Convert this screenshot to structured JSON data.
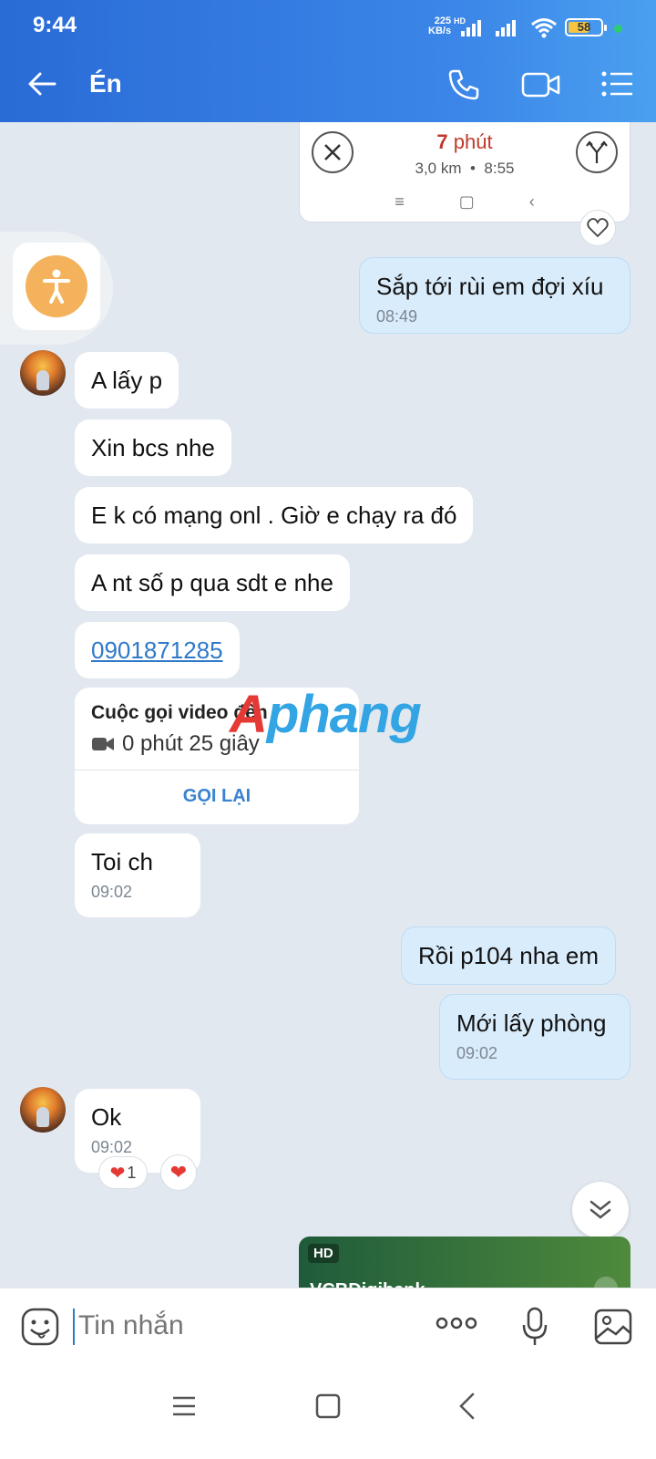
{
  "status_bar": {
    "time": "9:44",
    "net_speed_value": "225",
    "net_speed_unit": "KB/s",
    "signal_tag": "HD",
    "battery_level": "58"
  },
  "header": {
    "title": "Én"
  },
  "map_card": {
    "duration_number": "7",
    "duration_unit": "phút",
    "distance": "3,0 km",
    "arrival": "8:55"
  },
  "messages": [
    {
      "id": "out1",
      "text": "Sắp tới rùi em đợi xíu",
      "time": "08:49"
    },
    {
      "id": "in1",
      "text": "A lấy p"
    },
    {
      "id": "in2",
      "text": "Xin bcs nhe"
    },
    {
      "id": "in3",
      "text": "E k có mạng onl . Giờ e chạy ra đó"
    },
    {
      "id": "in4",
      "text": "A nt số p qua sdt e nhe"
    },
    {
      "id": "in5",
      "text": "0901871285"
    },
    {
      "id": "in6",
      "text": "Toi ch",
      "time": "09:02"
    },
    {
      "id": "out2",
      "text": "Rồi  p104 nha em"
    },
    {
      "id": "out3",
      "text": "Mới lấy phòng",
      "time": "09:02"
    },
    {
      "id": "in7",
      "text": "Ok",
      "time": "09:02"
    }
  ],
  "call_card": {
    "title": "Cuộc gọi video đến",
    "duration": "0 phút 25 giây",
    "action": "GỌI LẠI"
  },
  "watermark": {
    "part1": "A",
    "part2": "phang"
  },
  "reactions": {
    "heart_count": "1"
  },
  "bank_card": {
    "badge": "HD",
    "name": "VCBDigibank"
  },
  "composer": {
    "placeholder": "Tin nhắn"
  },
  "colors": {
    "header_blue": "#3b86e8",
    "outgoing_bubble": "#d9ecfb",
    "link_blue": "#2f79c9",
    "accessibility_orange": "#f4b25c",
    "heart_red": "#e53935"
  }
}
